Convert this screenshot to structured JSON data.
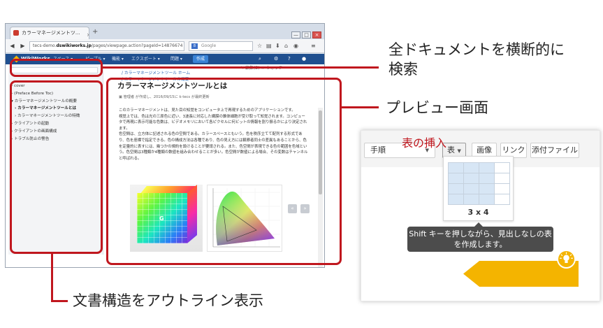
{
  "browser": {
    "tab_title": "カラーマネージメントツ...",
    "tab_close": "×",
    "new_tab": "+",
    "window_buttons": [
      "—",
      "□",
      "×"
    ],
    "url_prefix": "tecs-demo.",
    "url_host": "dswikiworks.jp",
    "url_path": "/pages/viewpage.action?pageId=14876674",
    "search_engine": "8",
    "search_placeholder": "Google",
    "icons": [
      "back-icon",
      "forward-icon",
      "reload-icon",
      "bookmark-star-icon",
      "library-icon",
      "download-icon",
      "home-icon",
      "pocket-icon",
      "menu-icon"
    ]
  },
  "wiki": {
    "logo": "WikiWorks",
    "menus": [
      "スペース ▾",
      "ピープル ▾",
      "機能 ▾",
      "エクスポート ▾",
      "問題 ▾"
    ],
    "create_button": "作成",
    "search_glyph": "⌕"
  },
  "sidebar": {
    "items": [
      {
        "label": "cover",
        "level": 0,
        "active": false
      },
      {
        "label": "(Preface Before Toc)",
        "level": 0,
        "active": false
      },
      {
        "label": "カラーマネージメントツールの概要",
        "level": 0,
        "active": false
      },
      {
        "label": "カラーマネージメントツールとは",
        "level": 1,
        "active": true
      },
      {
        "label": "カラーマネージメントツールの特徴",
        "level": 1,
        "active": false
      },
      {
        "label": "クライアントの起動",
        "level": 0,
        "active": false
      },
      {
        "label": "クライアントの画面構成",
        "level": 0,
        "active": false
      },
      {
        "label": "トラブル防止の警告",
        "level": 0,
        "active": false
      }
    ]
  },
  "document": {
    "actions": "✎ 編集(E)   ☆ ウォッチ",
    "breadcrumb": [
      "/ カラーマネージメントツール ホーム",
      "/ カラーマネージメントツールの概要"
    ],
    "title": "カラーマネージメントツールとは",
    "meta": "管理者 が作成し、2016/09/15に k-tecs が最終更新",
    "paragraphs": [
      "このカラーマネージメントは、見た目の知覚をコンピュータ上で再現するためのアプリケーションです。",
      "視覚上では、色は光の三原色に近い、3波長に対応した網膜の錐体細胞が受け取って知覚されます。コンピュータで再現に表示可能な色数は、ビデオメモリにおいて各ピクセルに何ビットの情報を割り振るかにより決定されます。",
      "色空間は、立方体に記述される色の空間である。カラースペースともいう。色を秩序立てて配列する形式であり、色を座標で指定できる。色の構成方法は各種であり、色の見え方には観察者同士の差異もあることから、色を定量的に表すには、幾つかの規約を設けることが要請される。また、色空間が表現できる色の範囲を色域という。色空間は3種類か4種類の数値を組み合わせることが多い。色空間が数値による場合、その変数はチャンネルと呼ばれる。"
    ],
    "cube_label": "G",
    "pager_prev": "«",
    "pager_next": "»"
  },
  "callouts": {
    "search": "全ドキュメントを横断的に\n検索",
    "preview": "プレビュー画面",
    "outline": "文書構造をアウトライン表示"
  },
  "editor": {
    "format_select": "手順",
    "table_button": "表",
    "image_button": "画像",
    "link_button": "リンク",
    "attach_button": "添付ファイル",
    "grid_label": "3 x 4",
    "grid_rows": 4,
    "grid_cols": 4,
    "selected_rows": 4,
    "selected_cols": 3,
    "tooltip": "Shift キーを押しながら、見出しなしの表を作成します。",
    "insert_badge": "表の挿入"
  },
  "colors": {
    "highlight_red": "#c0171e",
    "wiki_blue": "#1f4f8f",
    "badge_yellow": "#f4b400",
    "tooltip_bg": "#4c4c4c"
  }
}
